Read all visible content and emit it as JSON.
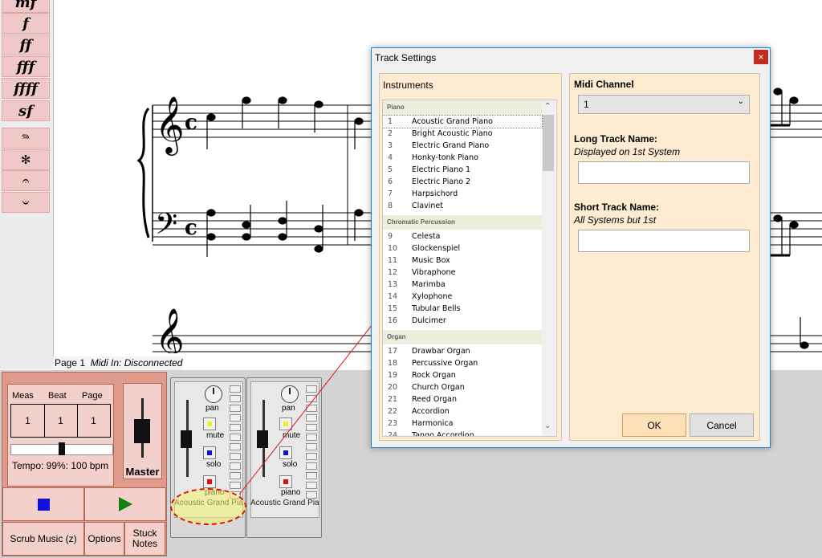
{
  "palette": {
    "items": [
      {
        "label": "mf",
        "icon": "mezzo-forte-icon"
      },
      {
        "label": "f",
        "icon": "forte-icon"
      },
      {
        "label": "ff",
        "icon": "fortissimo-icon"
      },
      {
        "label": "fff",
        "icon": "fortississimo-icon"
      },
      {
        "label": "ffff",
        "icon": "quadruple-forte-icon"
      },
      {
        "label": "sf",
        "icon": "sforzando-icon"
      },
      {
        "label": "𝆮",
        "icon": "pedal-down-icon"
      },
      {
        "label": "✻",
        "icon": "pedal-up-icon"
      },
      {
        "label": "𝄐",
        "icon": "fermata-icon"
      },
      {
        "label": "𝄑",
        "icon": "fermata-below-icon"
      }
    ]
  },
  "status": {
    "page": "Page 1",
    "midi": "Midi In: Disconnected"
  },
  "transport": {
    "meas_label": "Meas",
    "beat_label": "Beat",
    "page_label": "Page",
    "meas_value": "1",
    "beat_value": "1",
    "page_value": "1",
    "tempo": "Tempo: 99%: 100 bpm",
    "tempo_fraction": 0.5,
    "master_label": "Master",
    "scrub_label": "Scrub Music (z)",
    "options_label": "Options",
    "stuck_label": "Stuck Notes",
    "colors": {
      "stop": "#1010e0",
      "play": "#108010",
      "panel": "#e09a8a"
    }
  },
  "tracks": [
    {
      "pan": "pan",
      "mute": "mute",
      "solo": "solo",
      "instrument_short": "piano",
      "name": "Acoustic Grand Pia"
    },
    {
      "pan": "pan",
      "mute": "mute",
      "solo": "solo",
      "instrument_short": "piano",
      "name": "Acoustic Grand Pia"
    }
  ],
  "dialog": {
    "title": "Track Settings",
    "close": "×",
    "instruments_label": "Instruments",
    "midi_channel_label": "Midi Channel",
    "midi_channel_value": "1",
    "long_name_label": "Long Track Name:",
    "long_name_hint": "Displayed on 1st System",
    "long_name_value": "",
    "short_name_label": "Short Track Name:",
    "short_name_hint": "All Systems but 1st",
    "short_name_value": "",
    "ok_label": "OK",
    "cancel_label": "Cancel"
  },
  "instrument_groups": [
    {
      "name": "Piano",
      "items": [
        {
          "n": "1",
          "label": "Acoustic Grand Piano"
        },
        {
          "n": "2",
          "label": "Bright Acoustic Piano"
        },
        {
          "n": "3",
          "label": "Electric Grand Piano"
        },
        {
          "n": "4",
          "label": "Honky-tonk Piano"
        },
        {
          "n": "5",
          "label": "Electric Piano 1"
        },
        {
          "n": "6",
          "label": "Electric Piano 2"
        },
        {
          "n": "7",
          "label": "Harpsichord"
        },
        {
          "n": "8",
          "label": "Clavinet"
        }
      ]
    },
    {
      "name": "Chromatic Percussion",
      "items": [
        {
          "n": "9",
          "label": "Celesta"
        },
        {
          "n": "10",
          "label": "Glockenspiel"
        },
        {
          "n": "11",
          "label": "Music Box"
        },
        {
          "n": "12",
          "label": "Vibraphone"
        },
        {
          "n": "13",
          "label": "Marimba"
        },
        {
          "n": "14",
          "label": "Xylophone"
        },
        {
          "n": "15",
          "label": "Tubular Bells"
        },
        {
          "n": "16",
          "label": "Dulcimer"
        }
      ]
    },
    {
      "name": "Organ",
      "items": [
        {
          "n": "17",
          "label": "Drawbar Organ"
        },
        {
          "n": "18",
          "label": "Percussive Organ"
        },
        {
          "n": "19",
          "label": "Rock Organ"
        },
        {
          "n": "20",
          "label": "Church Organ"
        },
        {
          "n": "21",
          "label": "Reed Organ"
        },
        {
          "n": "22",
          "label": "Accordion"
        },
        {
          "n": "23",
          "label": "Harmonica"
        },
        {
          "n": "24",
          "label": "Tango Accordion"
        }
      ]
    }
  ],
  "annotation": {
    "highlight_color": "#f0f070",
    "outline_color": "#e01010"
  }
}
